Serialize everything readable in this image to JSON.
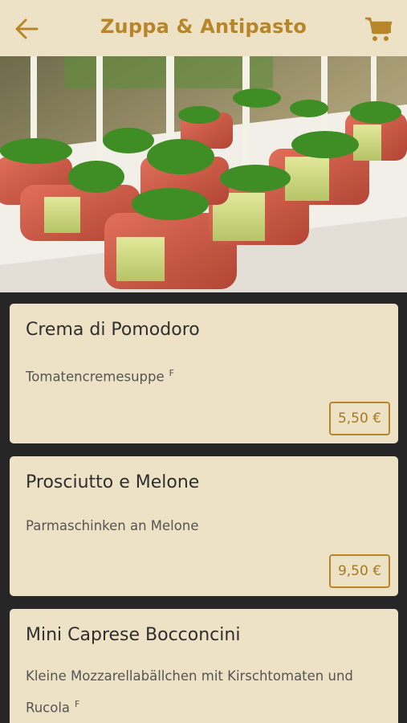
{
  "header": {
    "title": "Zuppa & Antipasto",
    "accent_color": "#b8862a",
    "background_color": "#eee2c6",
    "back_icon": "arrow-left-icon",
    "cart_icon": "shopping-cart-icon"
  },
  "hero": {
    "image": "prosciutto-melone-skewers-photo"
  },
  "menu": {
    "items": [
      {
        "name": "Crema di Pomodoro",
        "description": "Tomatencremesuppe",
        "allergen": "F",
        "price": "5,50 €"
      },
      {
        "name": "Prosciutto e Melone",
        "description": "Parmaschinken an Melone",
        "price": "9,50 €"
      },
      {
        "name": "Mini Caprese Bocconcini",
        "description": "Kleine Mozzarellabällchen mit Kirschtomaten und Rucola",
        "allergen": "F"
      }
    ]
  }
}
